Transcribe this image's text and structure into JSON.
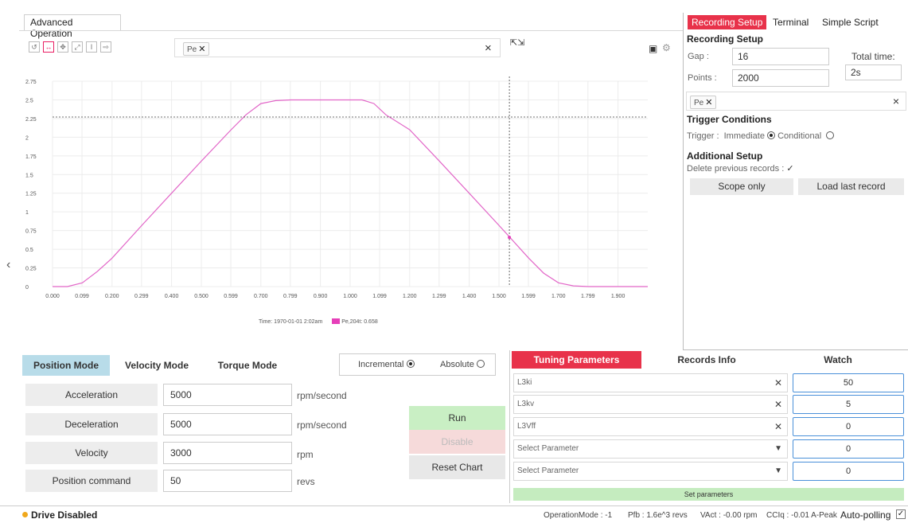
{
  "top": {
    "advanced_tab": "Advanced Operation",
    "signal_chip": "Pe",
    "clear_symbol": "×"
  },
  "chart_data": {
    "type": "line",
    "title": "",
    "xlabel": "",
    "ylabel": "",
    "x_ticks": [
      "0.000",
      "0.099",
      "0.200",
      "0.299",
      "0.400",
      "0.500",
      "0.599",
      "0.700",
      "0.799",
      "0.900",
      "1.000",
      "1.099",
      "1.200",
      "1.299",
      "1.400",
      "1.500",
      "1.599",
      "1.700",
      "1.799",
      "1.900"
    ],
    "y_ticks": [
      "0",
      "0.25",
      "0.5",
      "0.75",
      "1",
      "1.25",
      "1.5",
      "1.75",
      "2",
      "2.25",
      "2.5",
      "2.75"
    ],
    "xlim": [
      0,
      2.0
    ],
    "ylim": [
      0,
      2.75
    ],
    "series": [
      {
        "name": "Pe",
        "color": "#e266c8",
        "x": [
          0.0,
          0.05,
          0.1,
          0.15,
          0.2,
          0.3,
          0.4,
          0.5,
          0.6,
          0.65,
          0.7,
          0.75,
          0.8,
          0.9,
          1.0,
          1.04,
          1.08,
          1.12,
          1.2,
          1.3,
          1.4,
          1.5,
          1.6,
          1.65,
          1.7,
          1.75,
          1.8,
          1.9,
          2.0
        ],
        "y": [
          0.0,
          0.0,
          0.05,
          0.2,
          0.38,
          0.82,
          1.25,
          1.68,
          2.1,
          2.3,
          2.45,
          2.49,
          2.5,
          2.5,
          2.5,
          2.5,
          2.45,
          2.3,
          2.1,
          1.68,
          1.25,
          0.82,
          0.38,
          0.18,
          0.05,
          0.01,
          0.0,
          0.0,
          0.0
        ]
      }
    ],
    "crosshair": {
      "x": 1.535,
      "y": 2.27
    },
    "legend": {
      "time_label": "Time: 1970-01-01 2:02am",
      "series_label": "Pe,204t: 0.658",
      "color": "#e63fb9"
    }
  },
  "recording": {
    "tabs": [
      "Recording Setup",
      "Terminal",
      "Simple Script"
    ],
    "heading": "Recording Setup",
    "gap_label": "Gap :",
    "gap_value": "16",
    "total_time_label": "Total time:",
    "total_time_value": "2s",
    "points_label": "Points :",
    "points_value": "2000",
    "chip": "Pe",
    "trigger_heading": "Trigger Conditions",
    "trigger_label": "Trigger :",
    "immediate_label": "Immediate",
    "conditional_label": "Conditional",
    "additional_heading": "Additional Setup",
    "delete_label": "Delete previous records :",
    "scope_only": "Scope only",
    "load_last": "Load last record"
  },
  "modes": {
    "tabs": [
      "Position Mode",
      "Velocity Mode",
      "Torque Mode"
    ],
    "incremental_label": "Incremental",
    "absolute_label": "Absolute",
    "rows": [
      {
        "label": "Acceleration",
        "value": "5000",
        "unit": "rpm/second"
      },
      {
        "label": "Deceleration",
        "value": "5000",
        "unit": "rpm/second"
      },
      {
        "label": "Velocity",
        "value": "3000",
        "unit": "rpm"
      },
      {
        "label": "Position command",
        "value": "50",
        "unit": "revs"
      }
    ],
    "run": "Run",
    "disable": "Disable",
    "reset_chart": "Reset Chart"
  },
  "tuning": {
    "tabs": [
      "Tuning Parameters",
      "Records Info",
      "Watch"
    ],
    "params": [
      {
        "name": "L3ki",
        "value": "50"
      },
      {
        "name": "L3kv",
        "value": "5"
      },
      {
        "name": "L3Vff",
        "value": "0"
      },
      {
        "name": "Select Parameter",
        "value": "0"
      },
      {
        "name": "Select Parameter",
        "value": "0"
      }
    ],
    "set_parameters": "Set parameters"
  },
  "status": {
    "drive": "Drive Disabled",
    "operation_mode": "OperationMode : -1",
    "pfb": "Pfb : 1.6e^3 revs",
    "vact": "VAct : -0.00 rpm",
    "cciq": "CCIq : -0.01 A-Peak",
    "auto_polling": "Auto-polling"
  },
  "colors": {
    "accent_red": "#e8324a",
    "mode_active": "#b8dce9",
    "run_green": "#c9efc4",
    "disable_pink": "#f6dada",
    "set_params_green": "#c5ecbf",
    "drive_dot": "#f0a81c"
  }
}
